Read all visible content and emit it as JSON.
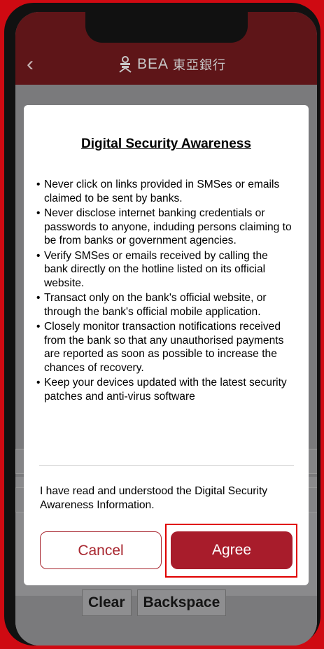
{
  "header": {
    "back_glyph": "‹",
    "logo_text_en": "BEA",
    "logo_text_zh": "東亞銀行"
  },
  "keypad": {
    "clear_label": "Clear",
    "backspace_label": "Backspace"
  },
  "dialog": {
    "title": "Digital Security Awareness",
    "items": [
      "Never click on links provided in SMSes or emails claimed to be sent by banks.",
      "Never disclose internet banking credentials or passwords to anyone, induding persons claiming to be from banks or government agencies.",
      "Verify SMSes or emails received by calling the bank directly on the hotline listed on its official website.",
      "Transact only on the bank's official website, or through the bank's official mobile application.",
      "Closely monitor transaction notifications received from the bank so that any unauthorised payments are reported as soon as possible to increase the chances of recovery.",
      "Keep your devices updated with the latest security patches and anti-virus software"
    ],
    "acknowledgement": "I have read and understood the Digital Security Awareness Information.",
    "cancel_label": "Cancel",
    "agree_label": "Agree"
  },
  "colors": {
    "frame_red": "#cf0a12",
    "brand_red": "#a81c2b",
    "header_dark": "#5e1518"
  }
}
